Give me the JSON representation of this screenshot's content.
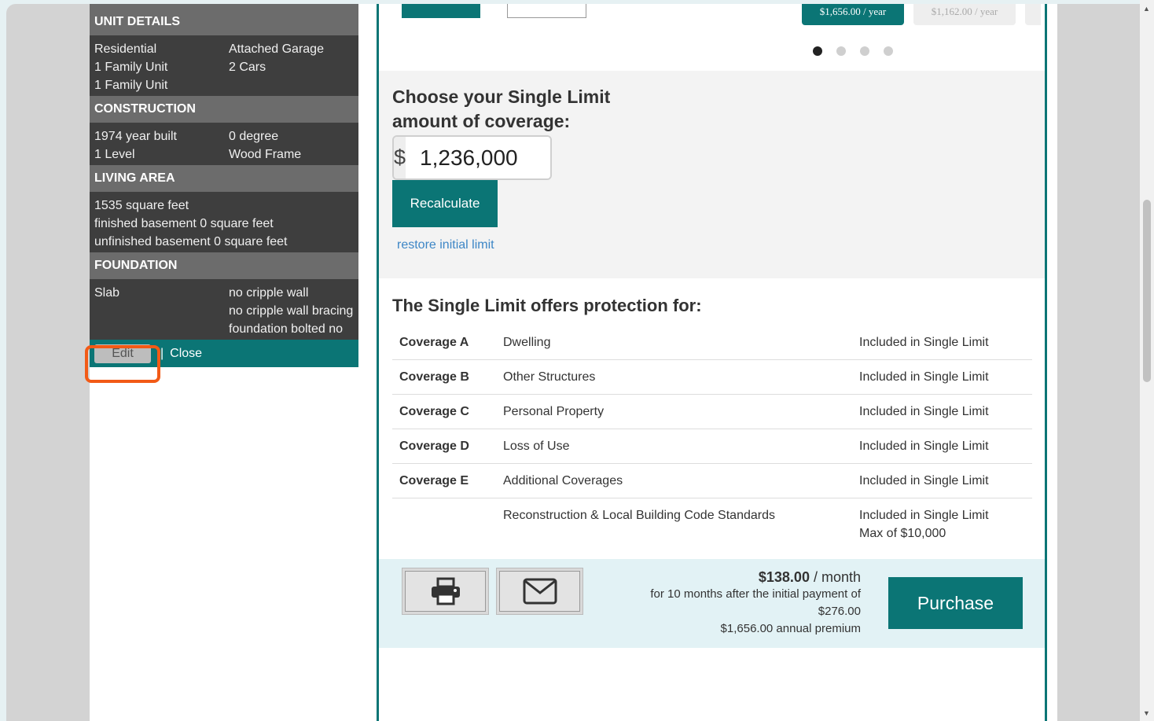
{
  "left": {
    "unit_details": {
      "title": "UNIT DETAILS",
      "col1": [
        "Residential",
        "1 Family Unit",
        "1 Family Unit"
      ],
      "col2": [
        "Attached Garage",
        "2 Cars"
      ]
    },
    "construction": {
      "title": "CONSTRUCTION",
      "col1": [
        "1974 year built",
        "1 Level"
      ],
      "col2": [
        "0 degree",
        "Wood Frame"
      ]
    },
    "living_area": {
      "title": "LIVING AREA",
      "lines": [
        "1535 square feet",
        "finished basement 0 square feet",
        "unfinished basement 0 square feet"
      ]
    },
    "foundation": {
      "title": "FOUNDATION",
      "col1": [
        "Slab"
      ],
      "col2": [
        "no cripple wall",
        "no cripple wall bracing",
        "foundation bolted no"
      ]
    },
    "edit_label": "Edit",
    "separator": "|",
    "close_label": "Close"
  },
  "carousel": {
    "price_a": "$1,656.00 / year",
    "price_b": "$1,162.00 / year",
    "active_dot": 0,
    "dot_count": 4
  },
  "limit": {
    "title": "Choose your Single Limit amount of coverage:",
    "currency": "$",
    "amount": "1,236,000",
    "recalculate_label": "Recalculate",
    "restore_label": "restore initial limit"
  },
  "protection": {
    "title": "The Single Limit offers protection for:",
    "rows": [
      {
        "code": "Coverage A",
        "name": "Dwelling",
        "status": "Included in Single Limit",
        "note": ""
      },
      {
        "code": "Coverage B",
        "name": "Other Structures",
        "status": "Included in Single Limit",
        "note": ""
      },
      {
        "code": "Coverage C",
        "name": "Personal Property",
        "status": "Included in Single Limit",
        "note": ""
      },
      {
        "code": "Coverage D",
        "name": "Loss of Use",
        "status": "Included in Single Limit",
        "note": ""
      },
      {
        "code": "Coverage E",
        "name": "Additional Coverages",
        "status": "Included in Single Limit",
        "note": ""
      },
      {
        "code": "",
        "name": "Reconstruction & Local Building Code Standards",
        "status": "Included in Single Limit",
        "note": "Max of $10,000"
      }
    ]
  },
  "footer": {
    "monthly_amount": "$138.00",
    "monthly_unit": " / month",
    "payment_line": "for 10 months after the initial payment of",
    "initial_payment": "$276.00",
    "annual_premium": "$1,656.00 annual premium",
    "purchase_label": "Purchase",
    "print_icon": "print-icon",
    "email_icon": "envelope-icon"
  },
  "colors": {
    "accent": "#0b7575",
    "highlight": "#f25a16"
  }
}
